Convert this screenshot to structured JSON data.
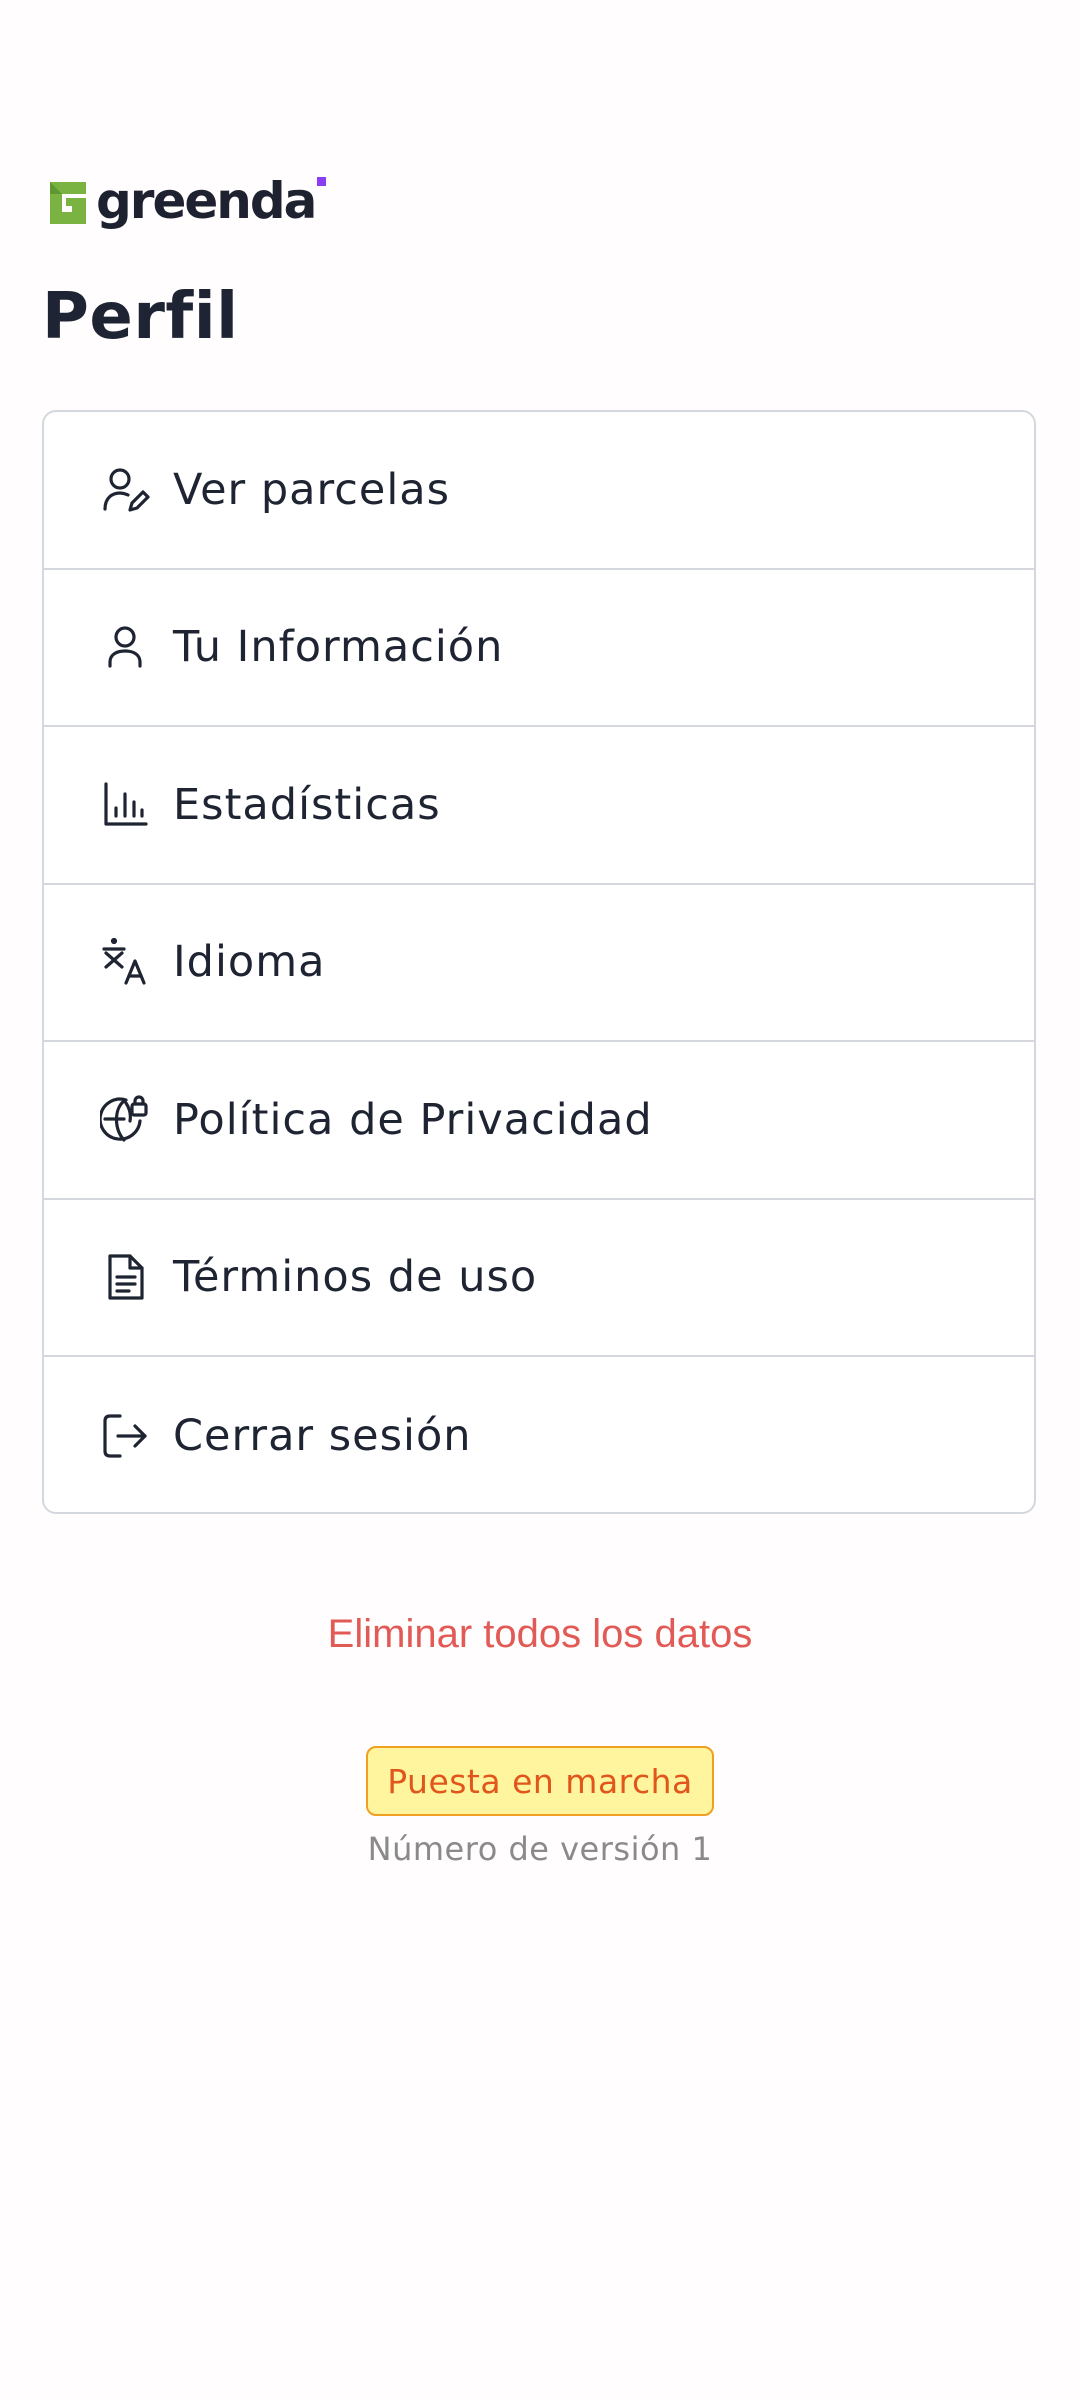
{
  "brand": {
    "name": "greenda",
    "primary_color": "#7ab342",
    "accent_color": "#8b3df4"
  },
  "page": {
    "title": "Perfil"
  },
  "menu": {
    "items": [
      {
        "label": "Ver parcelas",
        "icon": "user-edit-icon"
      },
      {
        "label": "Tu Información",
        "icon": "user-icon"
      },
      {
        "label": "Estadísticas",
        "icon": "bar-chart-icon"
      },
      {
        "label": "Idioma",
        "icon": "translate-icon"
      },
      {
        "label": "Política de Privacidad",
        "icon": "globe-lock-icon"
      },
      {
        "label": "Términos de uso",
        "icon": "document-icon"
      },
      {
        "label": "Cerrar sesión",
        "icon": "logout-icon"
      }
    ]
  },
  "danger": {
    "delete_label": "Eliminar todos los datos",
    "color": "#e25a56"
  },
  "footer": {
    "environment_badge": "Puesta en marcha",
    "version_text": "Número de versión 1"
  }
}
